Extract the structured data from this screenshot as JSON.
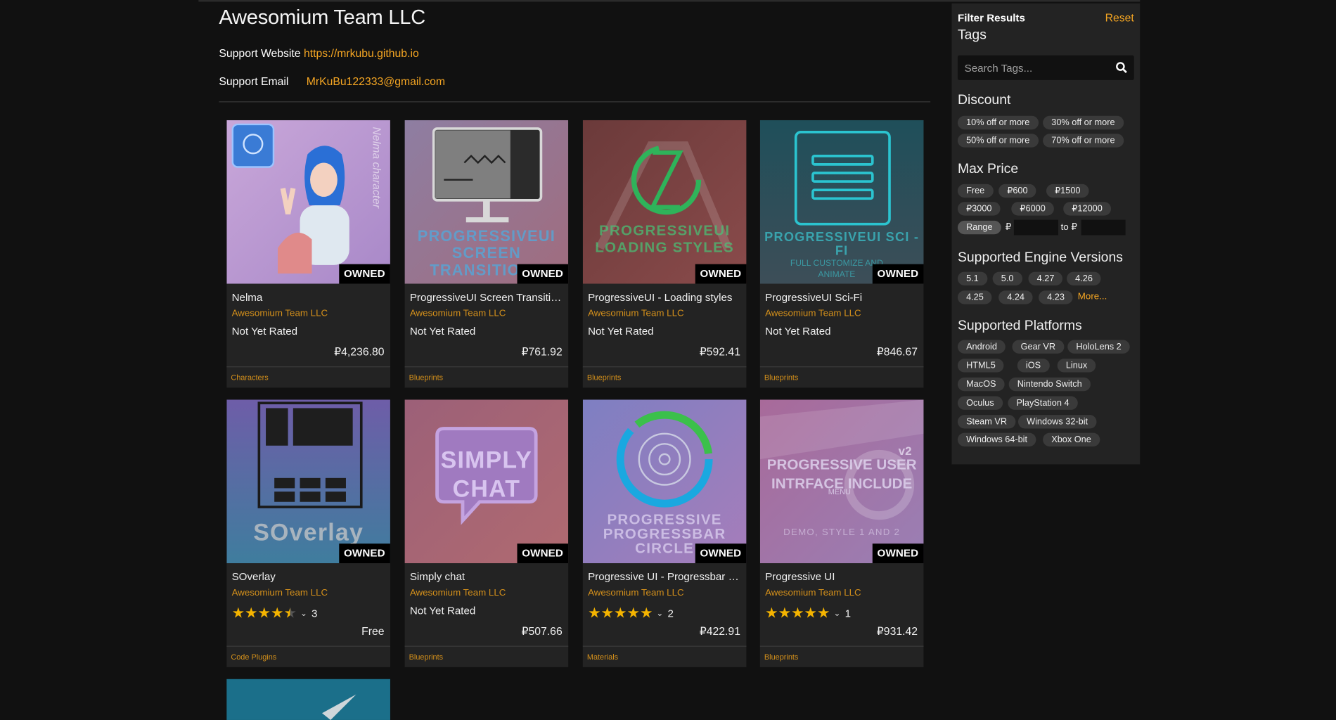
{
  "seller": {
    "name": "Awesomium Team LLC",
    "support_website_label": "Support Website",
    "support_website_url": "https://mrkubu.github.io",
    "support_email_label": "Support Email",
    "support_email": "MrKuBu122333@gmail.com"
  },
  "products": [
    {
      "name": "Nelma",
      "author": "Awesomium Team LLC",
      "rating_text": "Not Yet Rated",
      "price": "₽4,236.80",
      "category": "Characters",
      "badge": "OWNED",
      "thumb_text": "Nelma character"
    },
    {
      "name": "ProgressiveUI Screen Transitio...",
      "author": "Awesomium Team LLC",
      "rating_text": "Not Yet Rated",
      "price": "₽761.92",
      "category": "Blueprints",
      "badge": "OWNED",
      "thumb_text": "PROGRESSIVEUI SCREEN TRANSITIONS"
    },
    {
      "name": "ProgressiveUI - Loading styles",
      "author": "Awesomium Team LLC",
      "rating_text": "Not Yet Rated",
      "price": "₽592.41",
      "category": "Blueprints",
      "badge": "OWNED",
      "thumb_text": "PROGRESSIVEUI LOADING STYLES"
    },
    {
      "name": "ProgressiveUI Sci-Fi",
      "author": "Awesomium Team LLC",
      "rating_text": "Not Yet Rated",
      "price": "₽846.67",
      "category": "Blueprints",
      "badge": "OWNED",
      "thumb_text": "PROGRESSIVEUI SCI - FI",
      "thumb_sub": "FULL CUSTOMIZE AND ANIMATE"
    },
    {
      "name": "SOverlay",
      "author": "Awesomium Team LLC",
      "stars": 4.5,
      "review_count": "3",
      "price": "Free",
      "category": "Code Plugins",
      "badge": "OWNED",
      "thumb_text": "SOverlay"
    },
    {
      "name": "Simply chat",
      "author": "Awesomium Team LLC",
      "rating_text": "Not Yet Rated",
      "price": "₽507.66",
      "category": "Blueprints",
      "badge": "OWNED",
      "thumb_text": "SIMPLY CHAT"
    },
    {
      "name": "Progressive UI - Progressbar ci...",
      "author": "Awesomium Team LLC",
      "stars": 5,
      "review_count": "2",
      "price": "₽422.91",
      "category": "Materials",
      "badge": "OWNED",
      "thumb_text": "PROGRESSIVE PROGRESSBAR CIRCLE"
    },
    {
      "name": "Progressive UI",
      "author": "Awesomium Team LLC",
      "stars": 5,
      "review_count": "1",
      "price": "₽931.42",
      "category": "Blueprints",
      "badge": "OWNED",
      "thumb_text": "PROGRESSIVE USER INTRFACE INCLUDE",
      "thumb_sub": "DEMO, STYLE 1 AND 2",
      "thumb_tag": "v2",
      "thumb_menu": "MENU"
    }
  ],
  "filters": {
    "title": "Filter Results",
    "reset": "Reset",
    "tags_heading": "Tags",
    "tags_placeholder": "Search Tags...",
    "discount_heading": "Discount",
    "discounts": [
      "10% off or more",
      "30% off or more",
      "50% off or more",
      "70% off or more"
    ],
    "max_price_heading": "Max Price",
    "prices": [
      "Free",
      "₽600",
      "₽1500",
      "₽3000",
      "₽6000",
      "₽12000"
    ],
    "range_label": "Range",
    "currency": "₽",
    "to_label": "to ₽",
    "engine_heading": "Supported Engine Versions",
    "engines": [
      "5.1",
      "5.0",
      "4.27",
      "4.26",
      "4.25",
      "4.24",
      "4.23"
    ],
    "more": "More...",
    "platforms_heading": "Supported Platforms",
    "platforms": [
      "Android",
      "Gear VR",
      "HoloLens 2",
      "HTML5",
      "iOS",
      "Linux",
      "MacOS",
      "Nintendo Switch",
      "Oculus",
      "PlayStation 4",
      "Steam VR",
      "Windows 32-bit",
      "Windows 64-bit",
      "Xbox One"
    ]
  },
  "colors": {
    "accent": "#f5a623",
    "card_bg": "#232323",
    "page_bg": "#111111",
    "star": "#f5b400"
  }
}
